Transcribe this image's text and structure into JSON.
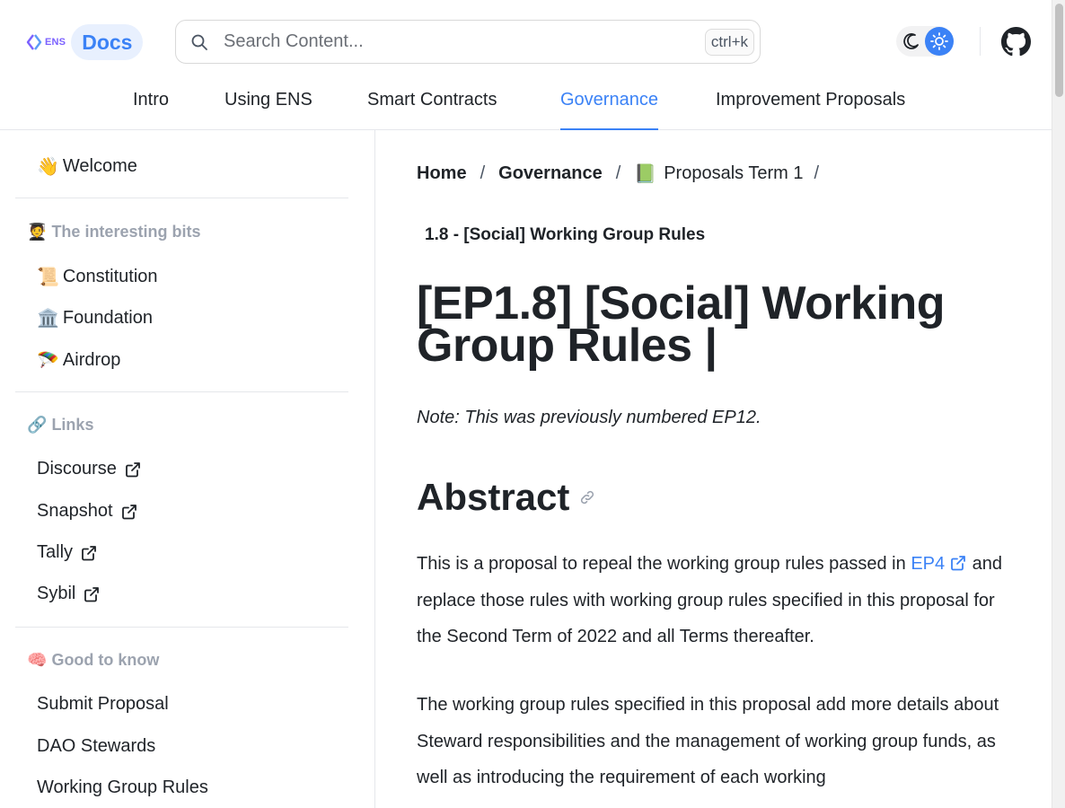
{
  "header": {
    "logo_text": "ENS",
    "docs_label": "Docs",
    "search_placeholder": "Search Content...",
    "search_shortcut": "ctrl+k",
    "theme_toggle": {
      "dark_icon": "moon-icon",
      "light_icon": "sun-icon",
      "selected": "light"
    },
    "github_icon": "github-icon",
    "tabs": [
      {
        "label": "Intro"
      },
      {
        "label": "Using ENS"
      },
      {
        "label": "Smart Contracts"
      },
      {
        "label": "Governance"
      },
      {
        "label": "Improvement Proposals"
      }
    ],
    "active_tab": "Governance"
  },
  "sidebar": {
    "welcome": {
      "emoji": "👋",
      "label": "Welcome"
    },
    "sections": [
      {
        "heading": "The interesting bits",
        "heading_emoji": "🧑‍🎓",
        "items": [
          {
            "emoji": "📜",
            "label": "Constitution"
          },
          {
            "emoji": "🏛️",
            "label": "Foundation"
          },
          {
            "emoji": "🪂",
            "label": "Airdrop"
          }
        ]
      },
      {
        "heading": "Links",
        "heading_emoji": "🔗",
        "items": [
          {
            "label": "Discourse",
            "external": true
          },
          {
            "label": "Snapshot",
            "external": true
          },
          {
            "label": "Tally",
            "external": true
          },
          {
            "label": "Sybil",
            "external": true
          }
        ]
      },
      {
        "heading": "Good to know",
        "heading_emoji": "🧠",
        "items": [
          {
            "label": "Submit Proposal"
          },
          {
            "label": "DAO Stewards"
          },
          {
            "label": "Working Group Rules"
          }
        ]
      }
    ]
  },
  "main": {
    "breadcrumb": {
      "home": "Home",
      "governance": "Governance",
      "term_emoji": "📗",
      "term": "Proposals Term 1",
      "separator": "/"
    },
    "subtitle": "1.8 - [Social] Working Group Rules",
    "title": "[EP1.8] [Social] Working Group Rules |",
    "note": "Note: This was previously numbered EP12.",
    "abstract_heading": "Abstract",
    "para1": {
      "before": "This is a proposal to repeal the working group rules passed in ",
      "link": "EP4",
      "after": " and replace those rules with working group rules specified in this proposal for the Second Term of 2022 and all Terms thereafter."
    },
    "para2": "The working group rules specified in this proposal add more details about Steward responsibilities and the management of working group funds, as well as introducing the requirement of each working"
  },
  "colors": {
    "accent": "#3b82f6",
    "ens_purple": "#7b61ff",
    "muted": "#9ca3af",
    "text": "#1f2328"
  }
}
